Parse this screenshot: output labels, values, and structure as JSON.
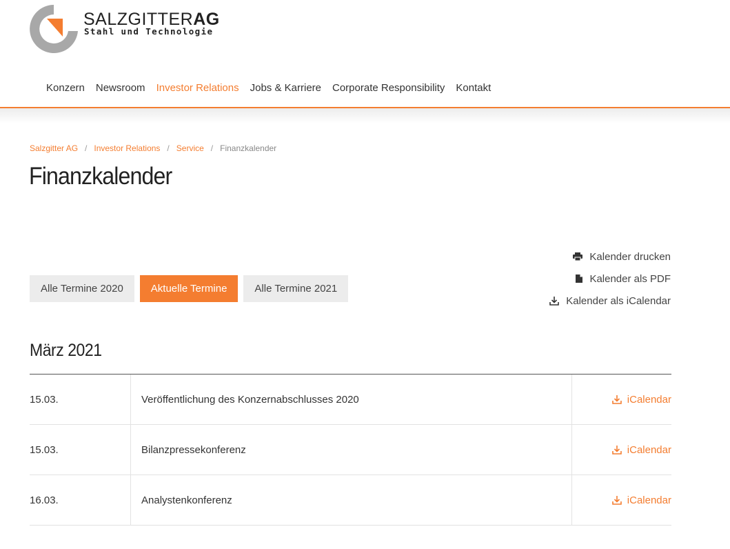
{
  "logo": {
    "name_light": "SALZGITTER",
    "name_bold": "AG",
    "tagline": "Stahl und Technologie"
  },
  "nav": {
    "items": [
      {
        "label": "Konzern"
      },
      {
        "label": "Newsroom"
      },
      {
        "label": "Investor Relations"
      },
      {
        "label": "Jobs & Karriere"
      },
      {
        "label": "Corporate Responsibility"
      },
      {
        "label": "Kontakt"
      }
    ]
  },
  "breadcrumb": {
    "items": [
      "Salzgitter AG",
      "Investor Relations",
      "Service"
    ],
    "current": "Finanzkalender",
    "separator": "/"
  },
  "page": {
    "title": "Finanzkalender"
  },
  "filters": {
    "items": [
      "Alle Termine 2020",
      "Aktuelle Termine",
      "Alle Termine 2021"
    ],
    "selected": "Aktuelle Termine"
  },
  "actions": {
    "print": "Kalender drucken",
    "pdf": "Kalender als PDF",
    "ical": "Kalender als iCalendar"
  },
  "month": {
    "title": "März 2021"
  },
  "events": [
    {
      "date": "15.03.",
      "title": "Veröffentlichung des Konzernabschlusses 2020",
      "link": "iCalendar"
    },
    {
      "date": "15.03.",
      "title": "Bilanzpressekonferenz",
      "link": "iCalendar"
    },
    {
      "date": "16.03.",
      "title": "Analystenkonferenz",
      "link": "iCalendar"
    }
  ],
  "colors": {
    "accent": "#f47d30",
    "logo_gray": "#a8a8a8",
    "button_bg": "#ececec"
  },
  "icons": {
    "print": "printer-icon",
    "pdf": "file-icon",
    "ical": "download-icon"
  }
}
